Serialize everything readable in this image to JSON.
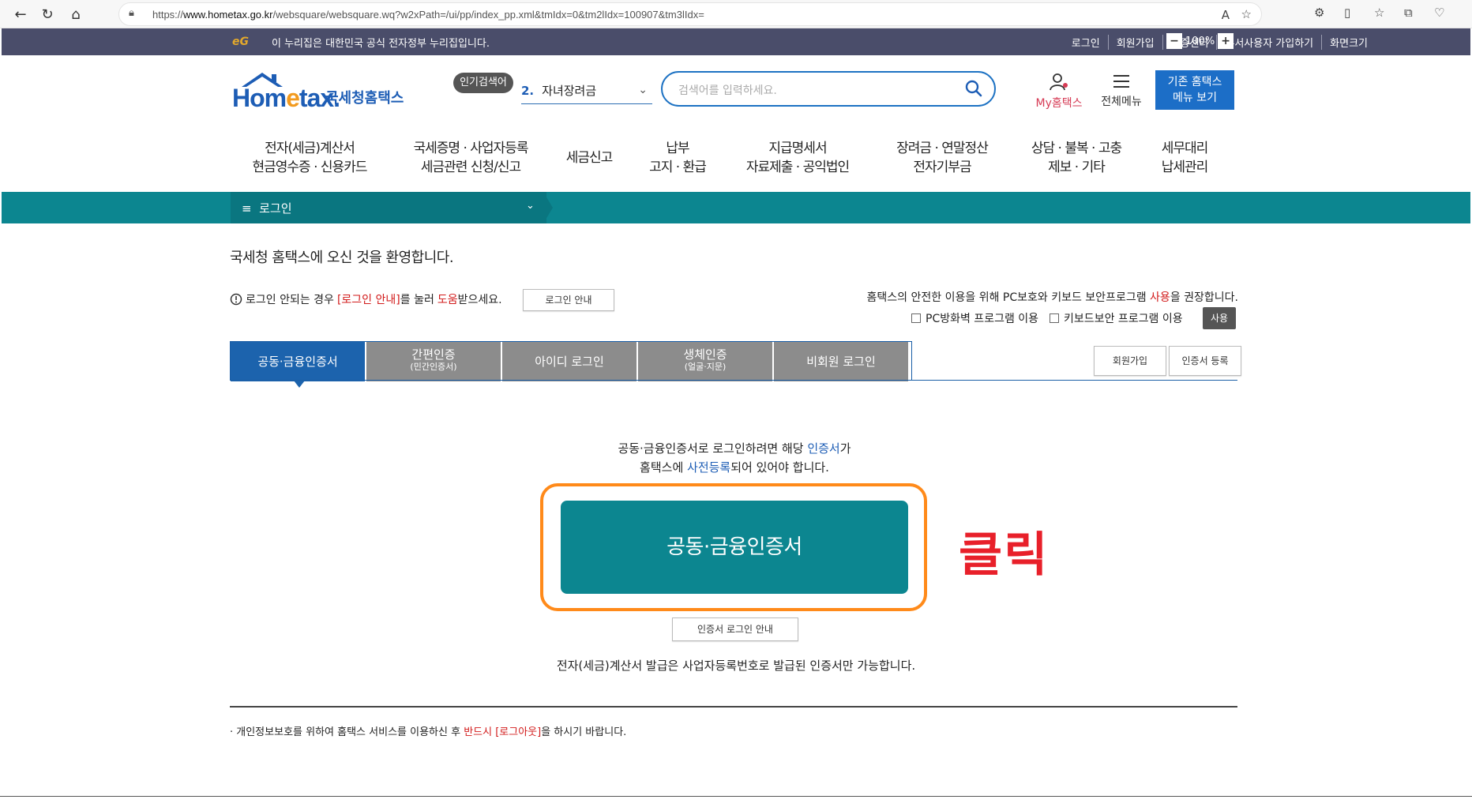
{
  "browser": {
    "url_prefix": "https://",
    "url_domain": "www.hometax.go.kr",
    "url_rest": "/websquare/websquare.wq?w2xPath=/ui/pp/index_pp.xml&tmIdx=0&tm2lIdx=100907&tm3lIdx="
  },
  "gov_banner": {
    "logo_text": "eG",
    "message": "이 누리집은 대한민국 공식 전자정부 누리집입니다.",
    "links": [
      "로그인",
      "회원가입",
      "인증센터",
      "부서사용자 가입하기",
      "화면크기"
    ],
    "zoom_minus": "−",
    "zoom_value": "100%",
    "zoom_plus": "+"
  },
  "header": {
    "logo_text_a": "Hom",
    "logo_text_b": "e",
    "logo_text_c": "tax.",
    "logo_kr": "국세청홈택스",
    "popular_label": "인기검색어",
    "popular_rank": "2.",
    "popular_term": "자녀장려금",
    "search_placeholder": "검색어를 입력하세요.",
    "my_hometax": "My홈택스",
    "all_menu": "전체메뉴",
    "old_menu_line1": "기존 홈택스",
    "old_menu_line2": "메뉴 보기"
  },
  "gnb": [
    {
      "line1": "전자(세금)계산서",
      "line2": "현금영수증 · 신용카드"
    },
    {
      "line1": "국세증명 · 사업자등록",
      "line2": "세금관련 신청/신고"
    },
    {
      "line1": "세금신고",
      "line2": ""
    },
    {
      "line1": "납부",
      "line2": "고지 · 환급"
    },
    {
      "line1": "지급명세서",
      "line2": "자료제출 · 공익법인"
    },
    {
      "line1": "장려금 · 연말정산",
      "line2": "전자기부금"
    },
    {
      "line1": "상담 · 불복 · 고충",
      "line2": "제보 · 기타"
    },
    {
      "line1": "세무대리",
      "line2": "납세관리"
    }
  ],
  "lnb": {
    "menu_icon": "≡",
    "label": "로그인"
  },
  "main": {
    "welcome": "국세청 홈택스에 오신 것을 환영합니다.",
    "help_pre": "로그인 안되는 경우",
    "help_link": "[로그인 안내]",
    "help_mid": "를 눌러",
    "help_red": "도움",
    "help_post": "받으세요.",
    "help_button": "로그인 안내",
    "security_pre": "홈택스의 안전한 이용을 위해 PC보호와 키보드 보안프로그램",
    "security_red": "사용",
    "security_post": "을 권장합니다.",
    "pc_firewall": "PC방화벽 프로그램 이용",
    "keyboard_security": "키보드보안 프로그램 이용",
    "use_button": "사용",
    "tabs": [
      {
        "label": "공동·금융인증서",
        "sub": ""
      },
      {
        "label": "간편인증",
        "sub": "(민간인증서)"
      },
      {
        "label": "아이디 로그인",
        "sub": ""
      },
      {
        "label": "생체인증",
        "sub": "(얼굴·지문)"
      },
      {
        "label": "비회원 로그인",
        "sub": ""
      }
    ],
    "join_button": "회원가입",
    "cert_register_button": "인증서 등록",
    "notice_a": "공동·금융인증서로 로그인하려면 해당",
    "notice_b": "인증서",
    "notice_c": "가",
    "notice_d": "홈택스에",
    "notice_e": "사전등록",
    "notice_f": "되어 있어야 합니다.",
    "cert_login_button": "공동·금융인증서",
    "annotation": "클릭",
    "cert_guide_button": "인증서 로그인 안내",
    "tax_invoice_note": "전자(세금)계산서 발급은 사업자등록번호로 발급된 인증서만 가능합니다.",
    "footer_pre": "개인정보보호를 위하여 홈택스 서비스를 이용하신 후",
    "footer_red": "반드시 [로그아웃]",
    "footer_post": "을 하시기 바랍니다."
  }
}
